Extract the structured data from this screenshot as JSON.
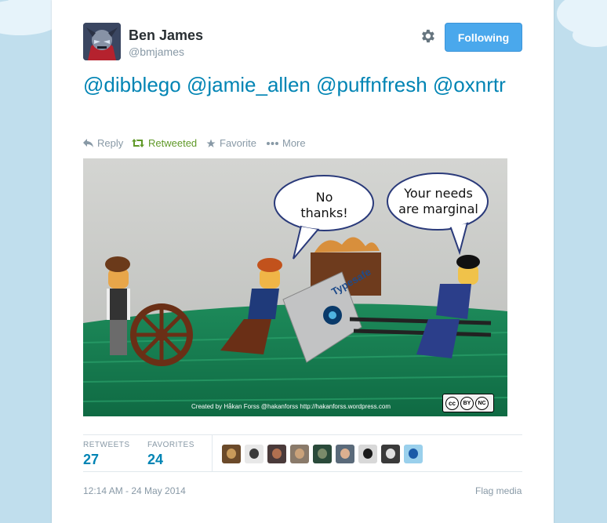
{
  "user": {
    "name": "Ben James",
    "handle": "@bmjames"
  },
  "follow_button": "Following",
  "tweet": {
    "mentions": [
      "@dibblego",
      "@jamie_allen",
      "@puffnfresh",
      "@oxnrtr"
    ]
  },
  "actions": {
    "reply": "Reply",
    "retweeted": "Retweeted",
    "favorite": "Favorite",
    "more": "More"
  },
  "media": {
    "bubble_left": "No\nthanks!",
    "bubble_right": "Your needs\nare marginal",
    "box_label": "Typesafe",
    "credit": "Created by Håkan Forss @hakanforss http://hakanforss.wordpress.com",
    "license": [
      "BY",
      "NC"
    ]
  },
  "stats": {
    "retweets_label": "RETWEETS",
    "retweets_count": "27",
    "favorites_label": "FAVORITES",
    "favorites_count": "24"
  },
  "favoriters_count": 9,
  "timestamp": "12:14 AM - 24 May 2014",
  "flag_media": "Flag media",
  "colors": {
    "link": "#0084b4",
    "button": "#4aa8ec",
    "retweeted": "#609928",
    "muted": "#8899a6",
    "background": "#c0deed"
  }
}
